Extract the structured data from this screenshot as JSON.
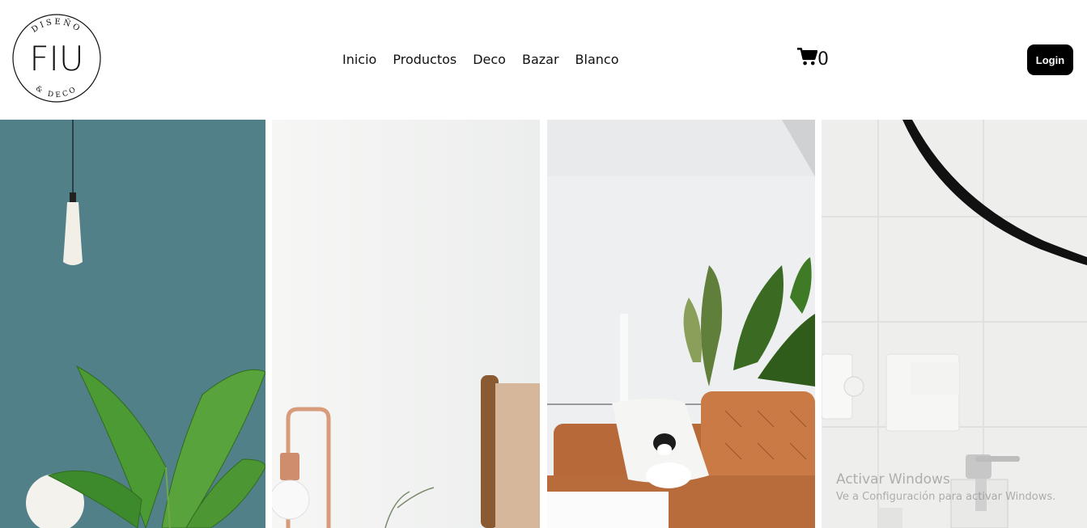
{
  "brand": {
    "logo_main": "FIU",
    "logo_top": "DISEÑO",
    "logo_bottom": "& DECO"
  },
  "nav": {
    "items": [
      {
        "label": "Inicio"
      },
      {
        "label": "Productos"
      },
      {
        "label": "Deco"
      },
      {
        "label": "Bazar"
      },
      {
        "label": "Blanco"
      }
    ]
  },
  "cart": {
    "icon": "shopping-cart-icon",
    "count": "0"
  },
  "login": {
    "label": "Login"
  },
  "gallery": {
    "panels": [
      {
        "subject": "plant-lamp-teal-wall-photo"
      },
      {
        "subject": "copper-lamp-white-wall-photo"
      },
      {
        "subject": "dog-on-leather-sofa-photo"
      },
      {
        "subject": "bathroom-mirror-soap-dispenser-photo"
      }
    ]
  },
  "watermark": {
    "line1": "Activar Windows",
    "line2": "Ve a Configuración para activar Windows."
  },
  "colors": {
    "login_bg": "#000000",
    "text": "#111111",
    "teal_wall": "#4f7d86",
    "leather": "#c97a45"
  }
}
